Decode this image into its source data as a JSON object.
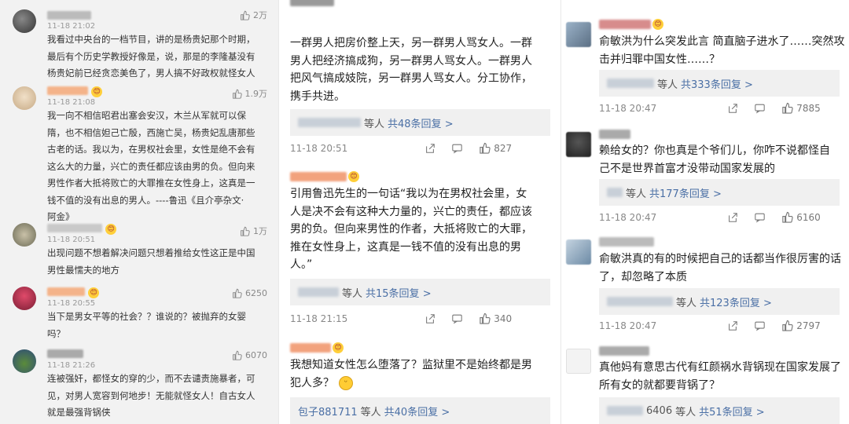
{
  "colors": {
    "panel1_bg": "#f2f2f2",
    "reply_bg": "#f0f0f0",
    "link": "#4a6fa5"
  },
  "icons": {
    "like": "thumbs-up-icon",
    "share": "share-icon",
    "comment": "comment-icon"
  },
  "panel1": {
    "comments": [
      {
        "time": "11-18 21:02",
        "likes": "2万",
        "text": "我看过中央台的一档节目，讲的是杨贵妃那个时期，\n最后有个历史学教授好像是，说，那是的李隆基没有\n杨贵妃前已经贪恋美色了，男人搞不好政权就怪女人"
      },
      {
        "time": "11-18 21:08",
        "likes": "1.9万",
        "text": "我一向不相信昭君出塞会安汉，木兰从军就可以保\n隋，也不相信妲己亡殷，西施亡吴，杨贵妃乱唐那些\n古老的话。我以为，在男权社会里，女性是绝不会有\n这么大的力量，兴亡的责任都应该由男的负。但向来\n男性作者大抵将败亡的大罪推在女性身上，这真是一\n钱不值的没有出息的男人。----鲁迅《且介亭杂文·\n阿金》"
      },
      {
        "time": "11-18 20:51",
        "likes": "1万",
        "text": "出现问题不想着解决问题只想着推给女性这正是中国\n男性最懦夫的地方"
      },
      {
        "time": "11-18 20:55",
        "likes": "6250",
        "text": "当下是男女平等的社会？？谁说的？被抛弃的女婴\n吗？"
      },
      {
        "time": "11-18 21:26",
        "likes": "6070",
        "text": "连被强奸，都怪女的穿的少，而不去谴责施暴者，可\n见，对男人宽容到何地步！无能就怪女人！自古女人\n就是最强背锅侠"
      }
    ]
  },
  "panel2": {
    "comments": [
      {
        "text": "一群男人把房价整上天，另一群男人骂女人。一群\n男人把经济搞成狗，另一群男人骂女人。一群男人\n把风气搞成妓院，另一群男人骂女人。分工协作，\n携手共进。",
        "reply_suffix": "等人",
        "reply_link": "共48条回复 >",
        "time": "11-18 20:51",
        "likes": "827"
      },
      {
        "text": "引用鲁迅先生的一句话“我以为在男权社会里，女\n人是决不会有这种大力量的，兴亡的责任，都应该\n男的负。但向来男性的作者，大抵将败亡的大罪，\n推在女性身上，这真是一钱不值的没有出息的男\n人。”",
        "reply_suffix": "等人",
        "reply_link": "共15条回复 >",
        "time": "11-18 21:15",
        "likes": "340"
      },
      {
        "text": "我想知道女性怎么堕落了？监狱里不是始终都是男\n犯人多？",
        "reply_name": "包子881711",
        "reply_suffix": "等人",
        "reply_link": "共40条回复 >"
      }
    ]
  },
  "panel3": {
    "comments": [
      {
        "text": "俞敏洪为什么突发此言 简直脑子进水了……突然攻\n击并归罪中国女性……？",
        "reply_suffix": "等人",
        "reply_link": "共333条回复 >",
        "time": "11-18 20:47",
        "likes": "7885"
      },
      {
        "text": "赖给女的？你也真是个爷们儿，你咋不说都怪自\n己不是世界首富才没带动国家发展的",
        "reply_suffix": "等人",
        "reply_link": "共177条回复 >",
        "time": "11-18 20:47",
        "likes": "6160"
      },
      {
        "text": "俞敏洪真的有的时候把自己的话都当作很厉害的话\n了，却忽略了本质",
        "reply_suffix": "等人",
        "reply_link": "共123条回复 >",
        "time": "11-18 20:47",
        "likes": "2797"
      },
      {
        "text": "真他妈有意思古代有红颜祸水背锅现在国家发展了\n所有女的就都要背锅了？",
        "reply_name": "6406",
        "reply_suffix": "等人",
        "reply_link": "共51条回复 >"
      }
    ]
  }
}
